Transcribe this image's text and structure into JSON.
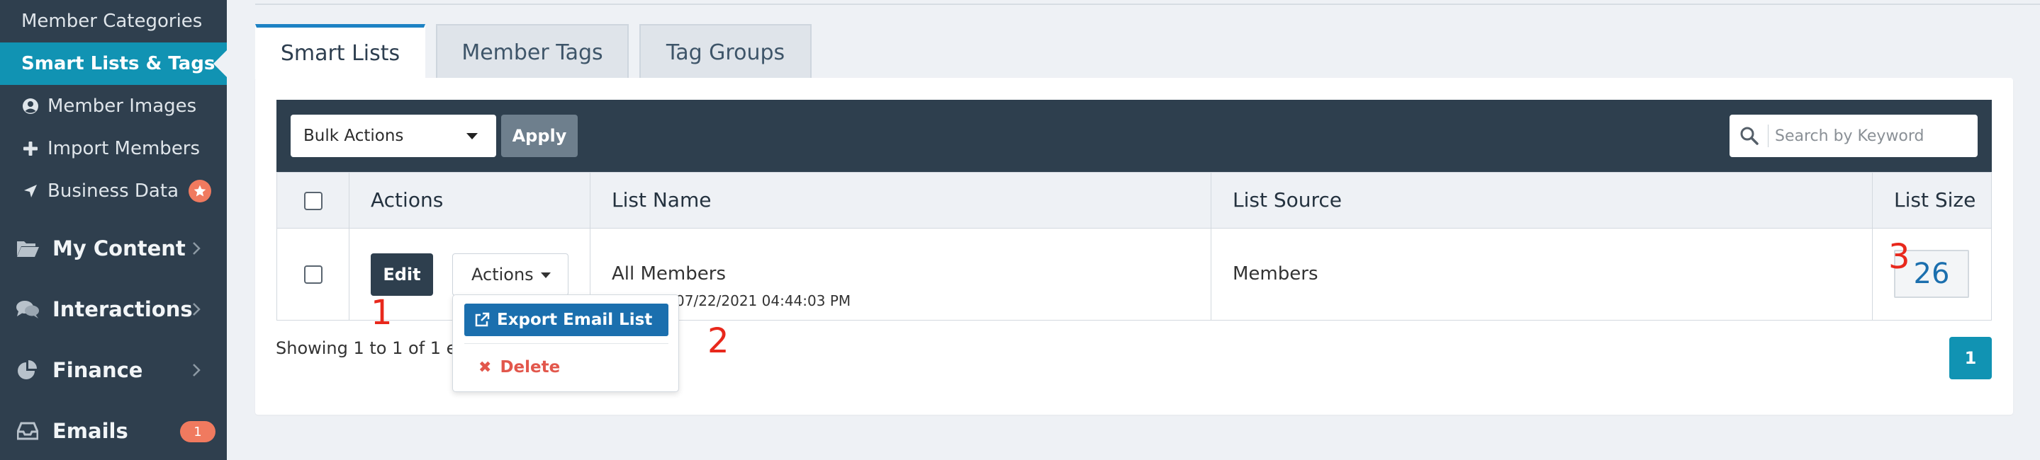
{
  "sidebar": {
    "sub_items": [
      {
        "label": "Member Categories",
        "icon": ""
      },
      {
        "label": "Smart Lists & Tags",
        "icon": "",
        "active": true
      },
      {
        "label": "Member Images",
        "icon": "user-circle-icon"
      },
      {
        "label": "Import Members",
        "icon": "plus-icon"
      },
      {
        "label": "Business Data",
        "icon": "location-arrow-icon",
        "badge_icon": "star-icon"
      }
    ],
    "main_items": [
      {
        "label": "My Content",
        "icon": "folder-open-icon"
      },
      {
        "label": "Interactions",
        "icon": "comments-icon"
      },
      {
        "label": "Finance",
        "icon": "pie-chart-icon"
      },
      {
        "label": "Emails",
        "icon": "inbox-icon",
        "badge": "1"
      }
    ]
  },
  "tabs": [
    {
      "label": "Smart Lists",
      "active": true
    },
    {
      "label": "Member Tags",
      "active": false
    },
    {
      "label": "Tag Groups",
      "active": false
    }
  ],
  "toolbar": {
    "bulk_actions": "Bulk Actions",
    "apply": "Apply",
    "search_placeholder": "Search by Keyword"
  },
  "table": {
    "headers": {
      "actions": "Actions",
      "list_name": "List Name",
      "list_source": "List Source",
      "list_size": "List Size"
    },
    "rows": [
      {
        "edit": "Edit",
        "actions": "Actions",
        "list_name": "All Members",
        "date": "07/22/2021 04:44:03 PM",
        "list_source": "Members",
        "list_size": "26"
      }
    ]
  },
  "dropdown": {
    "export": "Export Email List",
    "delete": "Delete"
  },
  "footer": {
    "showing": "Showing 1 to 1 of 1 entries",
    "page": "1"
  },
  "annotations": [
    "1",
    "2",
    "3"
  ],
  "colors": {
    "sidebar_bg": "#2f3f4e",
    "sidebar_active": "#1193b3",
    "toolbar_bg": "#2e3f4e",
    "primary_blue": "#1b6fae",
    "badge": "#f07a5f",
    "danger": "#e2574c",
    "annotation": "#e8281c"
  }
}
